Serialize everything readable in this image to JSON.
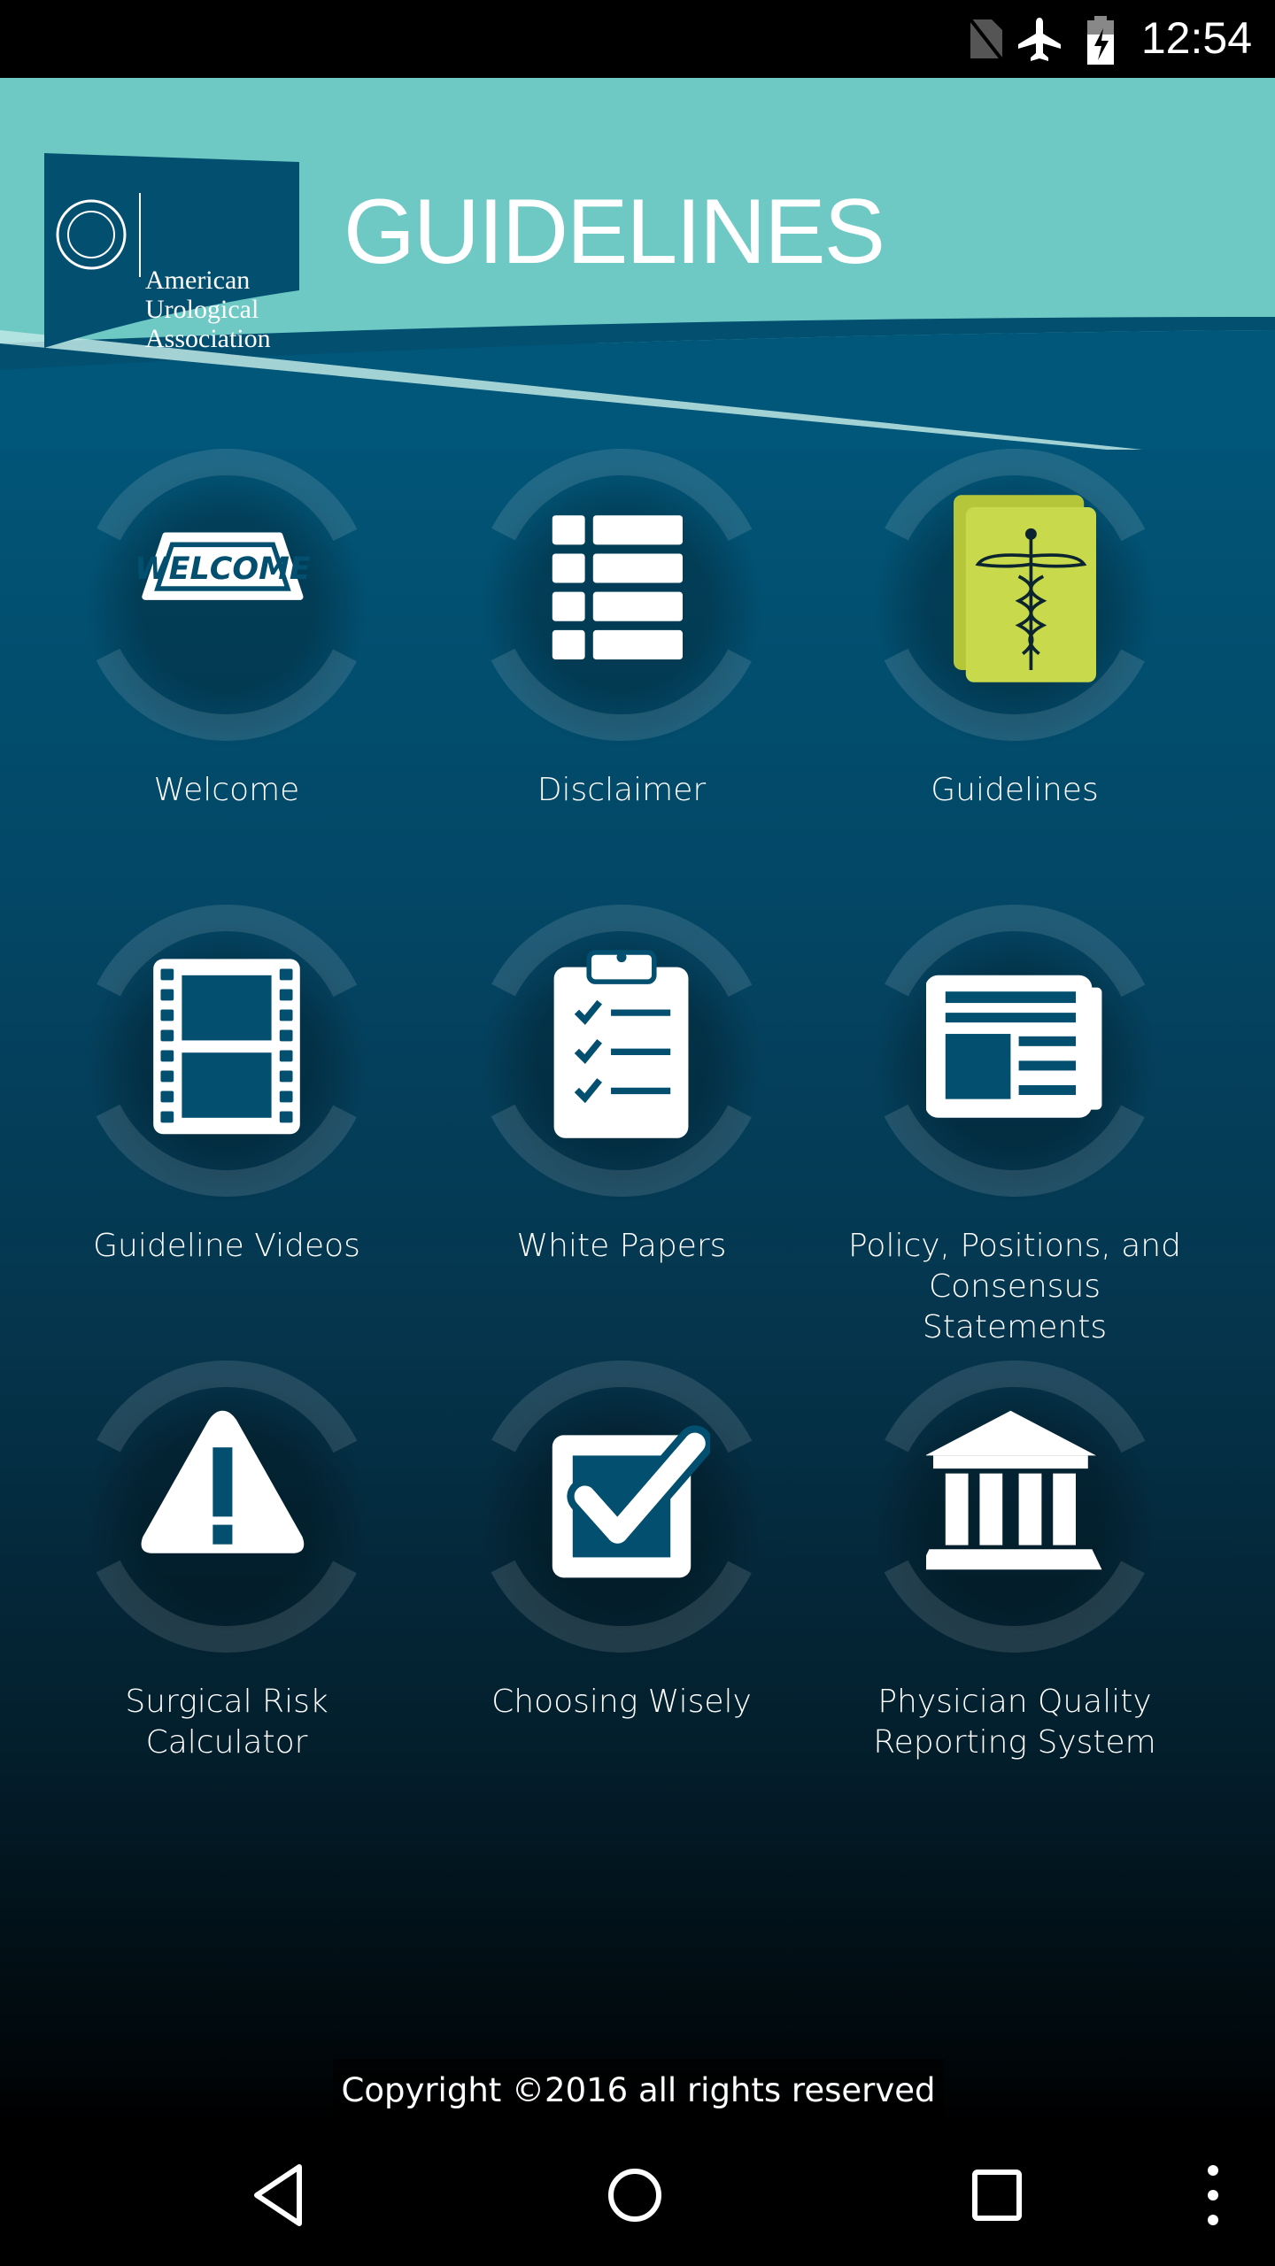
{
  "status_bar": {
    "time": "12:54",
    "icons": [
      "no-sim-icon",
      "airplane-mode-icon",
      "battery-charging-icon"
    ]
  },
  "header": {
    "logo_text": [
      "American",
      "Urological",
      "Association"
    ],
    "title": "GUIDELINES"
  },
  "colors": {
    "header_teal": "#6ec8c4",
    "navy": "#01577a",
    "icon_lime": "#c8d94b"
  },
  "tiles": [
    {
      "label": "Welcome",
      "icon": "welcome-sign-icon"
    },
    {
      "label": "Disclaimer",
      "icon": "list-icon"
    },
    {
      "label": "Guidelines",
      "icon": "caduceus-icon"
    },
    {
      "label": "Guideline Videos",
      "icon": "film-strip-icon"
    },
    {
      "label": "White Papers",
      "icon": "clipboard-checklist-icon"
    },
    {
      "label": "Policy, Positions, and Consensus Statements",
      "icon": "newspaper-icon"
    },
    {
      "label": "Surgical Risk Calculator",
      "icon": "warning-icon"
    },
    {
      "label": "Choosing Wisely",
      "icon": "checkbox-icon"
    },
    {
      "label": "Physician Quality Reporting System",
      "icon": "institution-icon"
    }
  ],
  "footer": {
    "copyright": "Copyright ©2016 all rights reserved"
  },
  "nav": {
    "buttons": [
      "back",
      "home",
      "recents",
      "menu"
    ]
  }
}
